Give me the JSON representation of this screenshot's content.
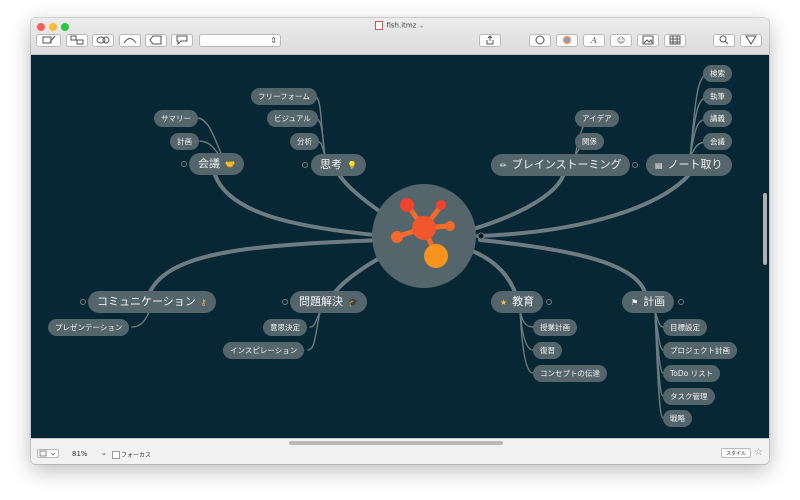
{
  "window": {
    "title": "fish.itmz",
    "traffic_colors": [
      "#fe5f57",
      "#febc2e",
      "#28c840"
    ]
  },
  "colors": {
    "canvas_bg": "#062733",
    "node_bg": "#55656c",
    "node_text": "#f2f4f4",
    "branch_line": "#6d7c82",
    "central_circle": "#55656c",
    "logo_red": "#f0432d",
    "logo_orange": "#f7931e"
  },
  "toolbar": {
    "icons": [
      "new-topic-icon",
      "subtopic-icon",
      "callout-icon",
      "relationship-icon",
      "boundary-icon",
      "comment-icon",
      "share-icon",
      "icon-library-icon",
      "colors-icon",
      "font-icon",
      "emoji-icon",
      "image-icon",
      "table-icon",
      "zoom-icon",
      "filter-icon"
    ],
    "select_value": ""
  },
  "central": {
    "logo": "imindmap-logo"
  },
  "branches": [
    {
      "label": "会議",
      "icon": "handshake-icon",
      "icon_char": "🤝",
      "children": [
        "サマリー",
        "計画"
      ]
    },
    {
      "label": "思考",
      "icon": "lightbulb-icon",
      "icon_char": "💡",
      "children": [
        "フリーフォーム",
        "ビジュアル",
        "分析"
      ]
    },
    {
      "label": "ブレインストーミング",
      "icon": "pencil-icon",
      "icon_char": "✏",
      "children": [
        "アイデア",
        "関係"
      ]
    },
    {
      "label": "ノート取り",
      "icon": "notepad-icon",
      "icon_char": "▤",
      "children": [
        "検索",
        "執筆",
        "講義",
        "会議"
      ]
    },
    {
      "label": "コミュニケーション",
      "icon": "key-icon",
      "icon_char": "⚷",
      "children": [
        "プレゼンテーション"
      ]
    },
    {
      "label": "問題解決",
      "icon": "graduation-cap-icon",
      "icon_char": "🎓",
      "children": [
        "意思決定",
        "インスピレーション"
      ]
    },
    {
      "label": "教育",
      "icon": "star-icon",
      "icon_char": "★",
      "children": [
        "授業計画",
        "復習",
        "コンセプトの伝達"
      ]
    },
    {
      "label": "計画",
      "icon": "flag-icon",
      "icon_char": "⚑",
      "children": [
        "目標設定",
        "プロジェクト計画",
        "ToDo リスト",
        "タスク管理",
        "戦略"
      ]
    }
  ],
  "statusbar": {
    "zoom": "81%",
    "focus_label": "フォーカス",
    "style_button": "スタイル"
  }
}
